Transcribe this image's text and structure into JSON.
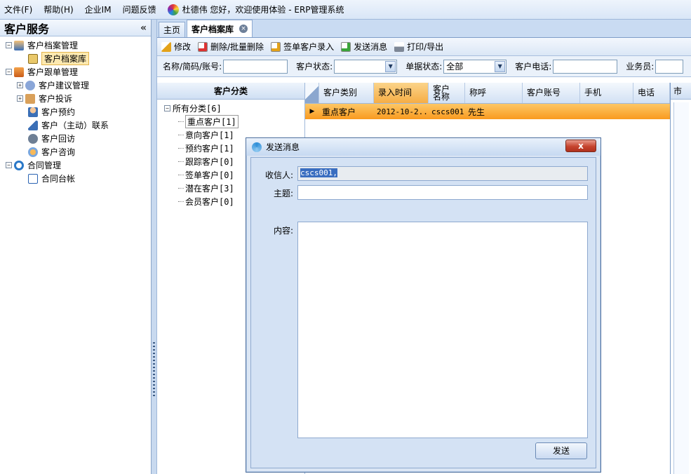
{
  "menubar": {
    "items": [
      "文件(F)",
      "帮助(H)",
      "企业IM",
      "问题反馈"
    ],
    "welcome": "杜德伟 您好，欢迎使用体验 - ERP管理系统"
  },
  "leftpanel": {
    "title": "客户服务",
    "collapse": "«",
    "tree": [
      {
        "label": "客户档案管理",
        "expander": "−"
      },
      {
        "label": "客户档案库"
      },
      {
        "label": "客户跟单管理",
        "expander": "−"
      },
      {
        "label": "客户建议管理",
        "expander": "+"
      },
      {
        "label": "客户投诉",
        "expander": "+"
      },
      {
        "label": "客户预约"
      },
      {
        "label": "客户（主动）联系"
      },
      {
        "label": "客户回访"
      },
      {
        "label": "客户咨询"
      },
      {
        "label": "合同管理",
        "expander": "−"
      },
      {
        "label": "合同台帐"
      }
    ]
  },
  "tabs": {
    "home": "主页",
    "active": "客户档案库",
    "close": "×"
  },
  "toolbar": {
    "edit": "修改",
    "delete": "删除/批量删除",
    "sign": "签单客户录入",
    "send": "发送消息",
    "print": "打印/导出"
  },
  "filter": {
    "name_label": "名称/简码/账号:",
    "status_label": "客户状态:",
    "doc_status_label": "单据状态:",
    "doc_status_value": "全部",
    "phone_label": "客户电话:",
    "salesman_label": "业务员:",
    "dropdown_arrow": "▼"
  },
  "categories": {
    "title": "客户分类",
    "root": "所有分类[6]",
    "root_expander": "−",
    "items": [
      "重点客户[1]",
      "意向客户[1]",
      "预约客户[1]",
      "跟踪客户[0]",
      "签单客户[0]",
      "潜在客户[3]",
      "会员客户[0]"
    ]
  },
  "grid": {
    "columns": [
      "客户类别",
      "录入时间",
      "客户名称",
      "称呼",
      "客户账号",
      "手机",
      "电话"
    ],
    "rows": [
      {
        "pointer": "▶",
        "cells": [
          "重点客户",
          "2012-10-2...",
          "cscs001",
          "先生",
          "",
          "",
          ""
        ]
      }
    ]
  },
  "rightpane": {
    "title": "市"
  },
  "dialog": {
    "title": "发送消息",
    "close": "x",
    "recipient_label": "收信人:",
    "recipient_value": "cscs001,",
    "subject_label": "主题:",
    "subject_value": "",
    "content_label": "内容:",
    "content_value": "",
    "send_button": "发送"
  }
}
